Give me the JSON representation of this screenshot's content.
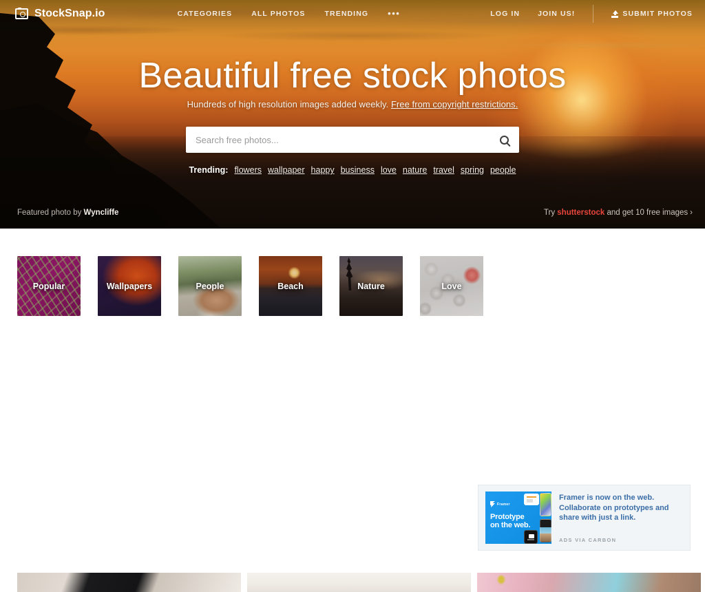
{
  "site": {
    "brand_name": "StockSnap.io",
    "brand_icon": "camera-icon"
  },
  "navbar": {
    "center_links": [
      {
        "label": "CATEGORIES",
        "name": "categories"
      },
      {
        "label": "ALL PHOTOS",
        "name": "all-photos"
      },
      {
        "label": "TRENDING",
        "name": "trending"
      }
    ],
    "more_label": "•••",
    "login_label": "LOG IN",
    "join_label": "JOIN US!",
    "submit_label": "SUBMIT PHOTOS",
    "submit_icon": "upload-icon"
  },
  "hero": {
    "title": "Beautiful free stock photos",
    "subtitle_text": "Hundreds of high resolution images added weekly. ",
    "subtitle_link": "Free from copyright restrictions.",
    "featured_prefix": "Featured photo by ",
    "featured_author": "Wyncliffe",
    "promo_prefix": "Try ",
    "promo_brand": "shutterstock",
    "promo_suffix": " and get 10 free images",
    "promo_arrow": "›",
    "promo_brand_color": "#e8463a"
  },
  "search": {
    "placeholder": "Search free photos...",
    "value": "",
    "icon": "search-icon"
  },
  "trending": {
    "label": "Trending:",
    "tags": [
      "flowers",
      "wallpaper",
      "happy",
      "business",
      "love",
      "nature",
      "travel",
      "spring",
      "people"
    ]
  },
  "categories": [
    {
      "label": "Popular",
      "key": "popular"
    },
    {
      "label": "Wallpapers",
      "key": "wallpapers"
    },
    {
      "label": "People",
      "key": "people"
    },
    {
      "label": "Beach",
      "key": "beach"
    },
    {
      "label": "Nature",
      "key": "nature"
    },
    {
      "label": "Love",
      "key": "love"
    }
  ],
  "ad": {
    "logo_text": "Framer",
    "image_headline_line1": "Prototype",
    "image_headline_line2": "on the web.",
    "body_line1": "Framer is now on the web.",
    "body_line2": "Collaborate on prototypes and",
    "body_line3": "share with just a link.",
    "via_label": "ADS VIA CARBON",
    "text_color": "#3b6ea8",
    "bg_color": "#f2f5f7"
  }
}
